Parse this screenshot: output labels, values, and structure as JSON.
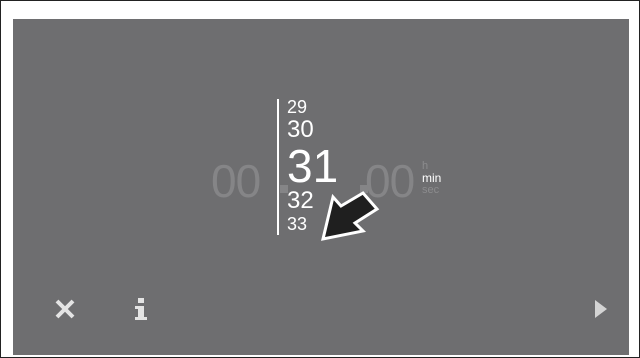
{
  "timer": {
    "hours": "00",
    "seconds": "00",
    "units": {
      "hours": "h",
      "minutes": "min",
      "seconds": "sec"
    },
    "minute_roller": {
      "prev2": "29",
      "prev1": "30",
      "selected": "31",
      "next1": "32",
      "next2": "33"
    }
  },
  "controls": {
    "close_icon": "close-icon",
    "info_icon": "info-icon",
    "play_icon": "play-icon"
  },
  "colors": {
    "screen_bg": "#6e6e70",
    "dim_text": "#858587",
    "active_text": "#ffffff"
  }
}
